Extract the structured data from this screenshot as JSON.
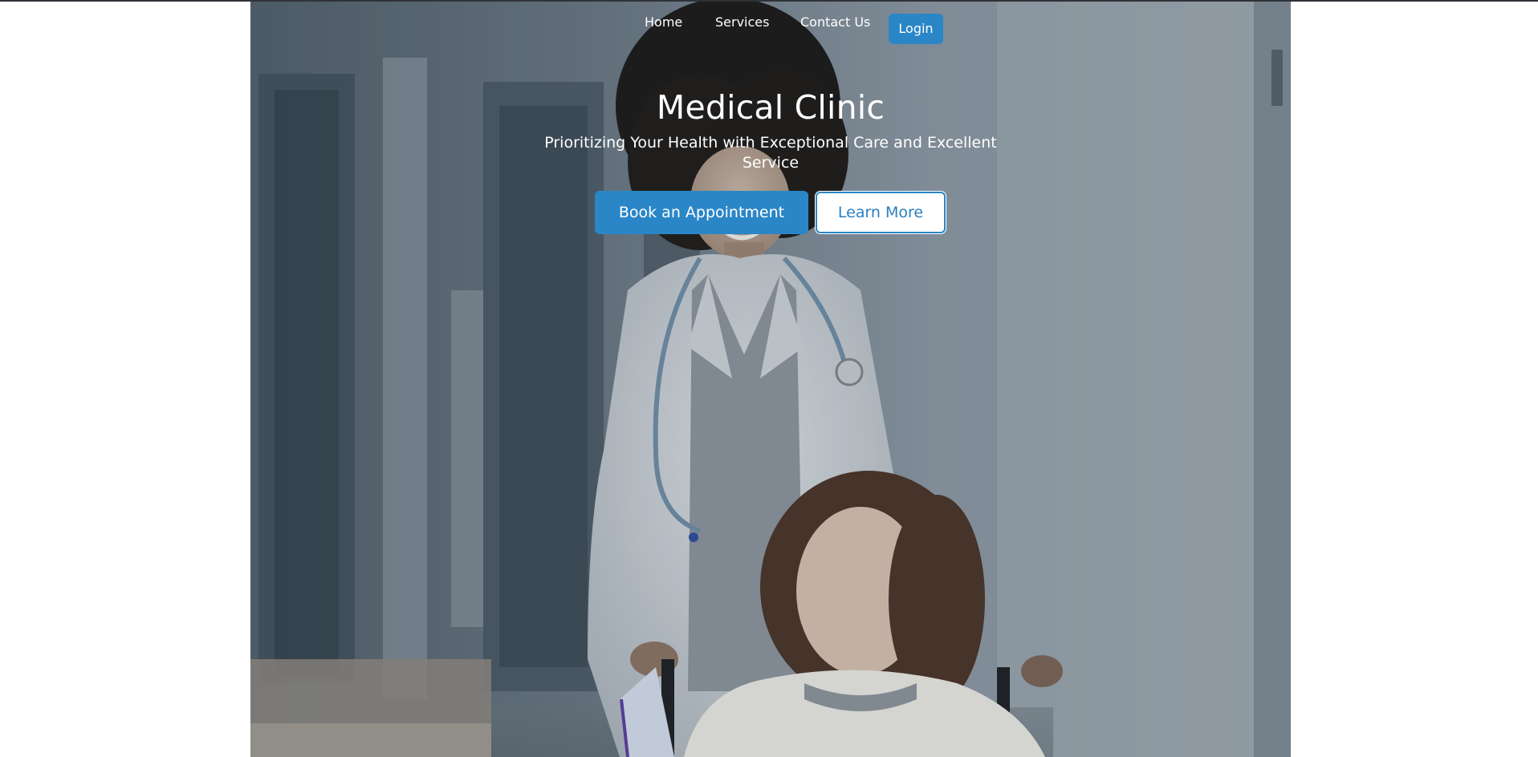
{
  "nav": {
    "links": [
      {
        "label": "Home"
      },
      {
        "label": "Services"
      },
      {
        "label": "Contact Us"
      }
    ],
    "login_label": "Login"
  },
  "hero": {
    "title": "Medical Clinic",
    "subtitle": "Prioritizing Your Health with Exceptional Care and Excellent Service",
    "primary_cta": "Book an Appointment",
    "secondary_cta": "Learn More",
    "background_description": "doctor-pushing-wheelchair-photo"
  },
  "colors": {
    "accent": "#2a86c7",
    "page_background": "#ffffff",
    "hero_text": "#ffffff"
  }
}
